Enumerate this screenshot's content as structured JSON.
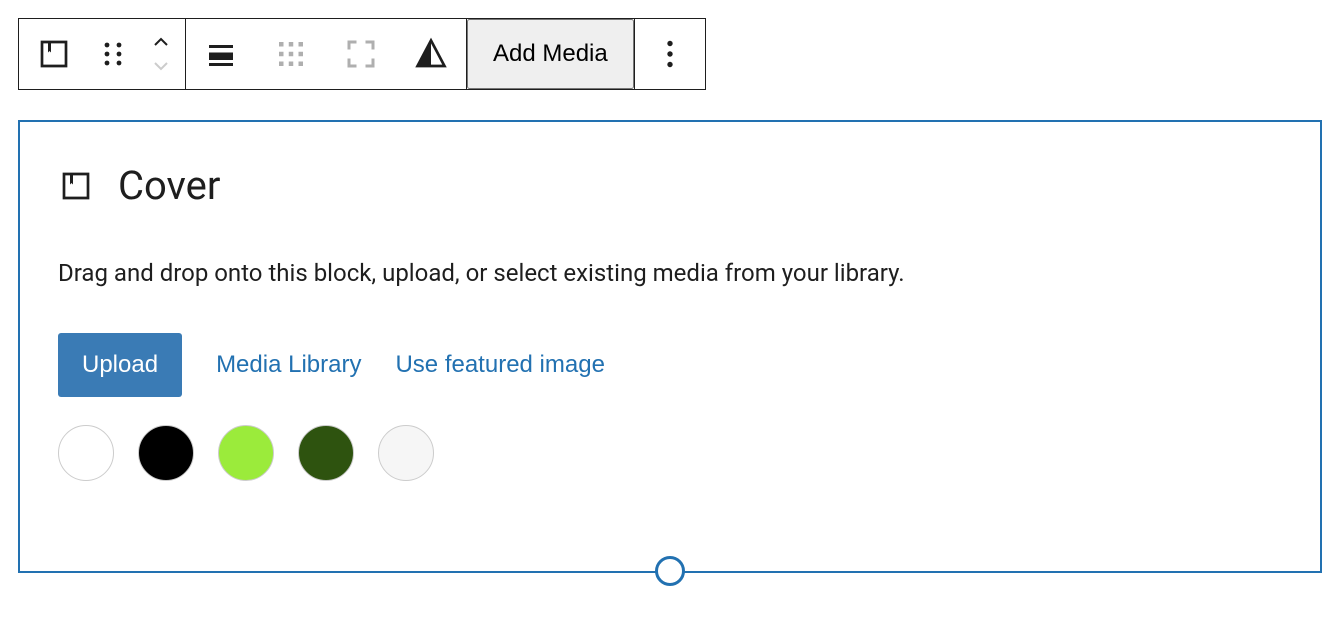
{
  "toolbar": {
    "add_media_label": "Add Media"
  },
  "placeholder": {
    "title": "Cover",
    "description": "Drag and drop onto this block, upload, or select existing media from your library.",
    "upload_label": "Upload",
    "media_library_label": "Media Library",
    "featured_image_label": "Use featured image"
  },
  "colors": {
    "swatches": [
      "#ffffff",
      "#000000",
      "#9BEB3B",
      "#2E530F",
      "#f6f6f6"
    ]
  }
}
